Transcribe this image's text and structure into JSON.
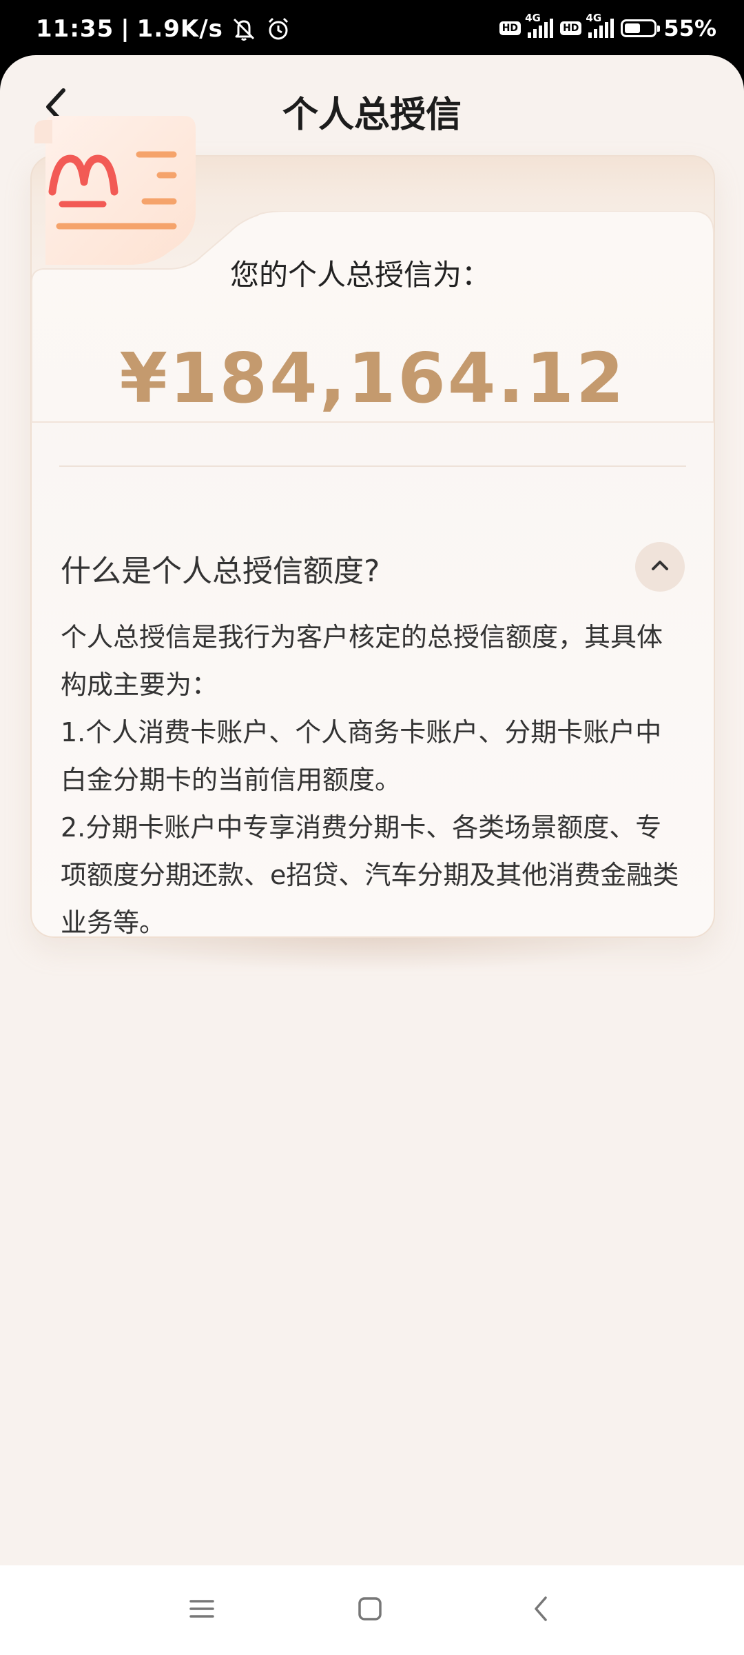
{
  "status_bar": {
    "time": "11:35",
    "network_speed": "1.9K/s",
    "battery_percent": "55%",
    "battery_level": 0.55,
    "sim1_badge": "HD",
    "sim1_network": "4G",
    "sim2_badge": "HD",
    "sim2_network": "4G",
    "icons": [
      "mute-icon",
      "alarm-icon",
      "signal-icon",
      "battery-icon"
    ]
  },
  "header": {
    "title": "个人总授信",
    "back_icon": "chevron-left-icon"
  },
  "credit": {
    "label": "您的个人总授信为：",
    "amount": "¥184,164.12"
  },
  "faq": {
    "question": "什么是个人总授信额度?",
    "toggle_icon": "chevron-up-icon",
    "paragraphs": [
      "个人总授信是我行为客户核定的总授信额度，其具体构成主要为：",
      "1.个人消费卡账户、个人商务卡账户、分期卡账户中白金分期卡的当前信用额度。",
      "2.分期卡账户中专享消费分期卡、各类场景额度、专项额度分期还款、e招贷、汽车分期及其他消费金融类业务等。"
    ]
  },
  "colors": {
    "accent_gold": "#c49a6e",
    "logo_red": "#f25a55",
    "logo_orange": "#f5a36b",
    "background": "#f8f2ee"
  },
  "system_nav": {
    "icons": [
      "menu-icon",
      "home-icon",
      "back-icon"
    ]
  }
}
